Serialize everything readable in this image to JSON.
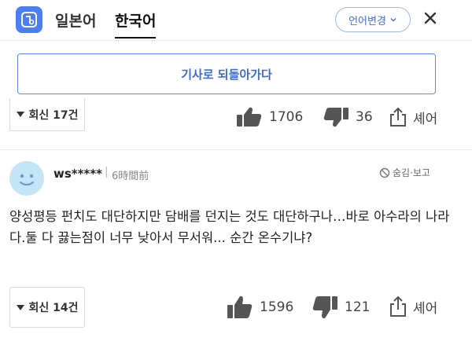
{
  "header": {
    "tabs": [
      {
        "label": "일본어",
        "active": false
      },
      {
        "label": "한국어",
        "active": true
      }
    ],
    "language_change_label": "언어변경",
    "accent_color": "#4a7ef2"
  },
  "back_button_label": "기사로 되돌아가다",
  "comments": [
    {
      "reply_label": "회신 17건",
      "likes": "1706",
      "dislikes": "36",
      "share_label": "셰어"
    },
    {
      "username": "ws*****",
      "time": "6時間前",
      "hide_report_label": "숨김·보고",
      "text": "양성평등 펀치도 대단하지만 담배를 던지는 것도 대단하구나…바로 아수라의 나라다.둘 다 끓는점이 너무 낮아서 무서워... 순간 온수기냐?",
      "reply_label": "회신 14건",
      "likes": "1596",
      "dislikes": "121",
      "share_label": "셰어"
    }
  ]
}
